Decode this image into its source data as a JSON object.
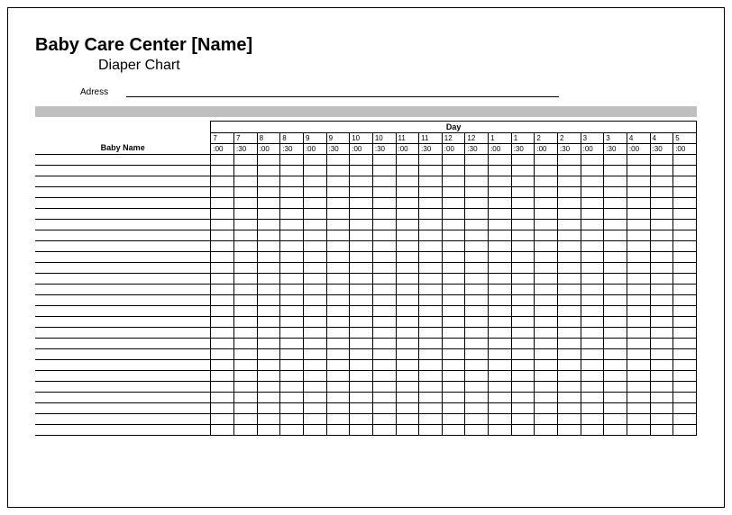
{
  "header": {
    "title": "Baby Care Center [Name]",
    "subtitle": "Diaper Chart",
    "address_label": "Adress"
  },
  "table": {
    "day_label": "Day",
    "name_label": "Baby Name",
    "time_columns": [
      {
        "hour": "7",
        "min": ":00"
      },
      {
        "hour": "7",
        "min": ":30"
      },
      {
        "hour": "8",
        "min": ":00"
      },
      {
        "hour": "8",
        "min": ":30"
      },
      {
        "hour": "9",
        "min": ":00"
      },
      {
        "hour": "9",
        "min": ":30"
      },
      {
        "hour": "10",
        "min": ":00"
      },
      {
        "hour": "10",
        "min": ":30"
      },
      {
        "hour": "11",
        "min": ":00"
      },
      {
        "hour": "11",
        "min": ":30"
      },
      {
        "hour": "12",
        "min": ":00"
      },
      {
        "hour": "12",
        "min": ":30"
      },
      {
        "hour": "1",
        "min": ":00"
      },
      {
        "hour": "1",
        "min": ":30"
      },
      {
        "hour": "2",
        "min": ":00"
      },
      {
        "hour": "2",
        "min": ":30"
      },
      {
        "hour": "3",
        "min": ":00"
      },
      {
        "hour": "3",
        "min": ":30"
      },
      {
        "hour": "4",
        "min": ":00"
      },
      {
        "hour": "4",
        "min": ":30"
      },
      {
        "hour": "5",
        "min": ":00"
      }
    ],
    "row_count": 26
  }
}
